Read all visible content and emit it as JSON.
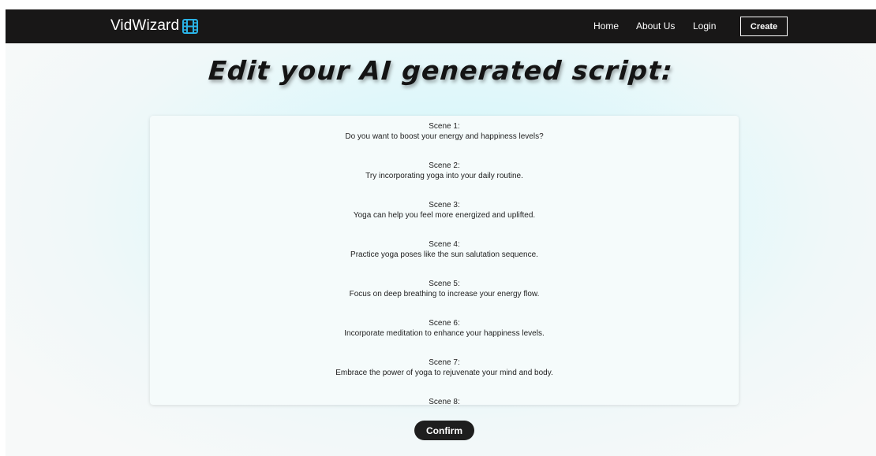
{
  "header": {
    "brand": "VidWizard",
    "brand_icon": "film-icon",
    "accent_color": "#2ab3e6",
    "nav": {
      "home": "Home",
      "about": "About Us",
      "login": "Login",
      "create": "Create"
    }
  },
  "main": {
    "title": "Edit your AI generated script:",
    "scenes": [
      {
        "heading": "Scene 1:",
        "text": "Do you want to boost your energy and happiness levels?"
      },
      {
        "heading": "Scene 2:",
        "text": "Try incorporating yoga into your daily routine."
      },
      {
        "heading": "Scene 3:",
        "text": "Yoga can help you feel more energized and uplifted."
      },
      {
        "heading": "Scene 4:",
        "text": "Practice yoga poses like the sun salutation sequence."
      },
      {
        "heading": "Scene 5:",
        "text": "Focus on deep breathing to increase your energy flow."
      },
      {
        "heading": "Scene 6:",
        "text": "Incorporate meditation to enhance your happiness levels."
      },
      {
        "heading": "Scene 7:",
        "text": "Embrace the power of yoga to rejuvenate your mind and body."
      },
      {
        "heading": "Scene 8:",
        "text": ""
      }
    ],
    "confirm_label": "Confirm"
  }
}
